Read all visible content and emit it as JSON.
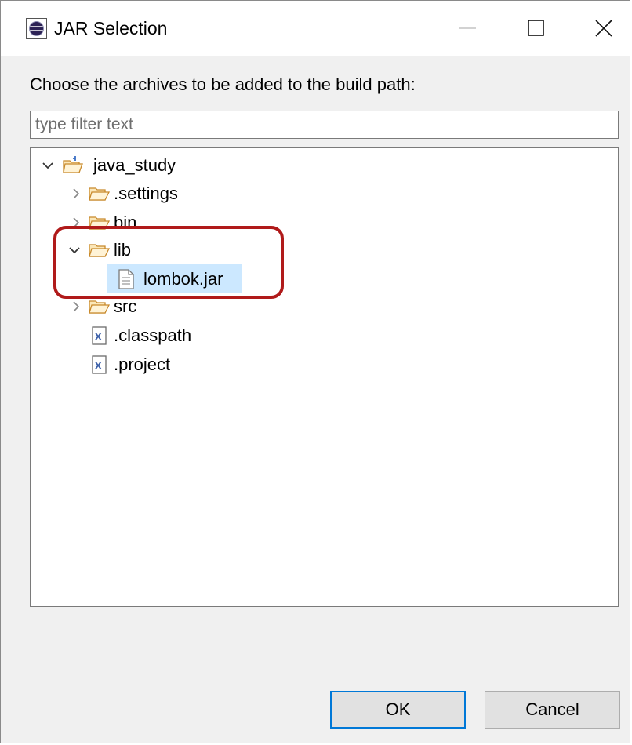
{
  "window": {
    "title": "JAR Selection"
  },
  "dialog": {
    "prompt": "Choose the archives to be added to the build path:",
    "filter_placeholder": "type filter text",
    "filter_value": ""
  },
  "tree": [
    {
      "label": "java_study",
      "depth": 0,
      "type": "project",
      "expanded": true
    },
    {
      "label": ".settings",
      "depth": 1,
      "type": "folder",
      "expanded": false
    },
    {
      "label": "bin",
      "depth": 1,
      "type": "folder",
      "expanded": false
    },
    {
      "label": "lib",
      "depth": 1,
      "type": "folder",
      "expanded": true
    },
    {
      "label": "lombok.jar",
      "depth": 2,
      "type": "jar",
      "selected": true
    },
    {
      "label": "src",
      "depth": 1,
      "type": "folder",
      "expanded": false
    },
    {
      "label": ".classpath",
      "depth": 1,
      "type": "xml"
    },
    {
      "label": ".project",
      "depth": 1,
      "type": "xml"
    }
  ],
  "buttons": {
    "ok": "OK",
    "cancel": "Cancel"
  },
  "colors": {
    "selection": "#cce8ff",
    "highlight_border": "#b01a1a",
    "default_button_border": "#0078d7",
    "folder_icon": "#e8a33a"
  },
  "icons": [
    "eclipse-app-icon",
    "minimize-icon",
    "maximize-icon",
    "close-icon",
    "chevron-down-icon",
    "chevron-right-icon",
    "project-folder-icon",
    "folder-icon",
    "jar-file-icon",
    "xml-file-icon"
  ]
}
